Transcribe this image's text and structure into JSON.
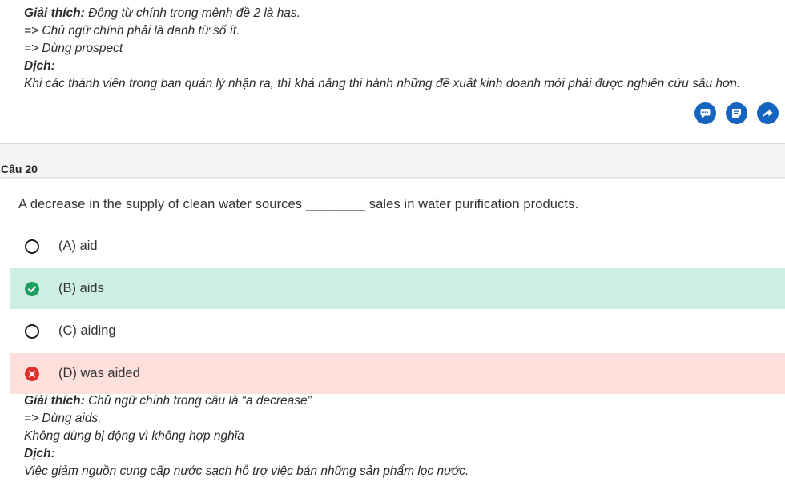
{
  "prev_explanation": {
    "heading": "Giải thích:",
    "heading_text": "Động từ chính trong mệnh đề 2 là has.",
    "line2": "=> Chủ ngữ chính phải là danh từ số ít.",
    "line3": "=> Dùng prospect",
    "translation_heading": "Dịch:",
    "translation": "Khi các thành viên trong ban quản lý nhận ra, thì khả năng thi hành những đề xuất kinh doanh mới phải được nghiên cứu sâu hơn."
  },
  "actions": {
    "icons": [
      "comment-icon",
      "note-icon",
      "share-icon"
    ],
    "color": "#1565c0"
  },
  "question": {
    "number_label": "Câu 20",
    "text": "A decrease in the supply of clean water sources ________ sales in water purification products.",
    "options": [
      {
        "label": "(A) aid",
        "state": "unselected"
      },
      {
        "label": "(B) aids",
        "state": "correct"
      },
      {
        "label": "(C) aiding",
        "state": "unselected"
      },
      {
        "label": "(D) was aided",
        "state": "wrong"
      }
    ]
  },
  "explanation": {
    "heading": "Giải thích:",
    "heading_text": "Chủ ngữ chính trong câu là “a decrease”",
    "line2": "=> Dùng aids.",
    "line3": "Không dùng bị động vì không hợp nghĩa",
    "translation_heading": "Dịch:",
    "translation": "Việc giảm nguồn cung cấp nước sạch hỗ trợ việc bán những sản phẩm lọc nước."
  },
  "colors": {
    "correct_bg": "#cdeee3",
    "wrong_bg": "#fddfdb",
    "correct_mark": "#1f9e62",
    "wrong_mark": "#e03030"
  }
}
